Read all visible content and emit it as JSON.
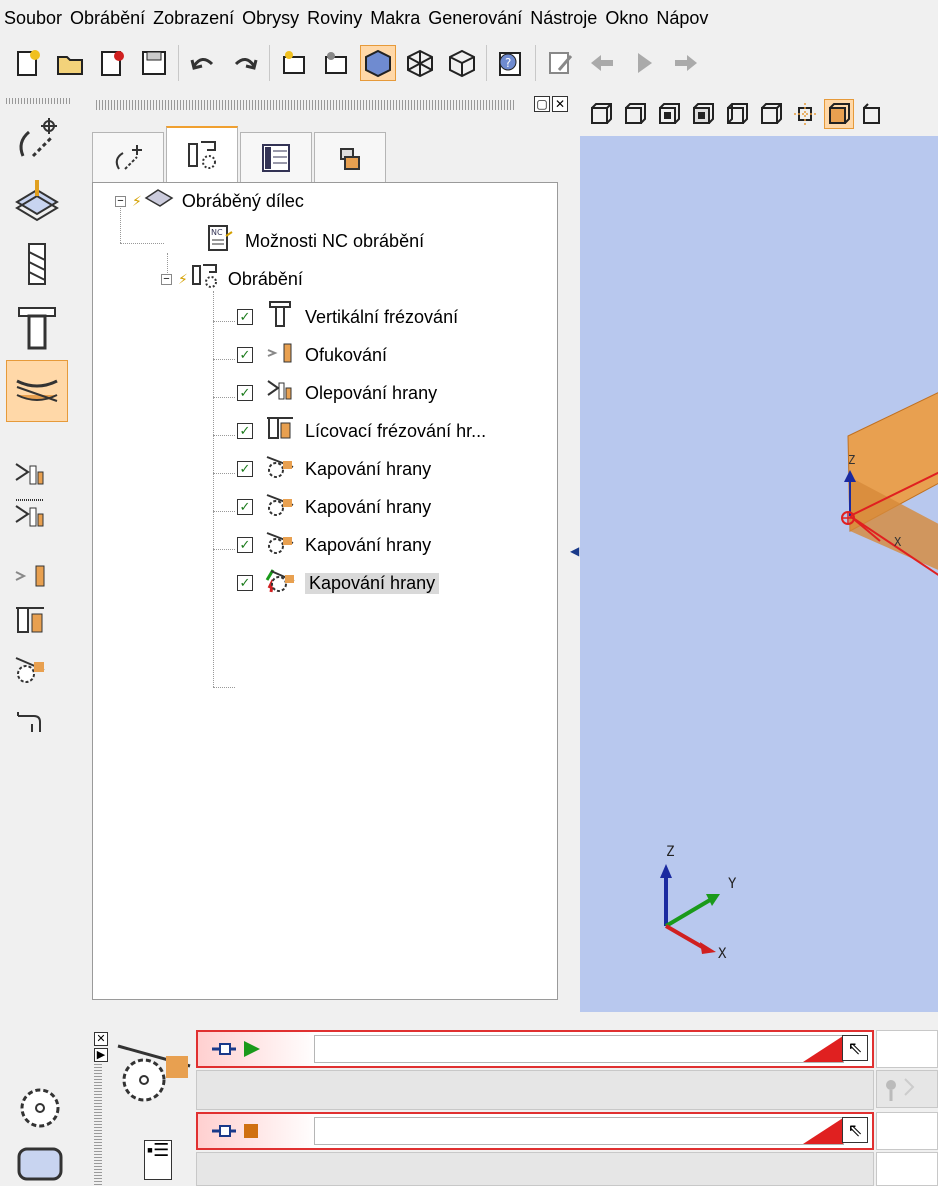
{
  "menu": [
    "Soubor",
    "Obrábění",
    "Zobrazení",
    "Obrysy",
    "Roviny",
    "Makra",
    "Generování",
    "Nástroje",
    "Okno",
    "Nápov"
  ],
  "toolbar": {
    "icons": [
      "new-document-icon",
      "open-folder-icon",
      "close-document-icon",
      "save-icon",
      "undo-icon",
      "redo-icon",
      "new-part-icon",
      "part-settings-icon",
      "solid-view-icon",
      "wireframe-view-icon",
      "hidden-line-view-icon",
      "help-icon",
      "edit-icon",
      "back-arrow-icon",
      "play-icon",
      "forward-arrow-icon"
    ]
  },
  "tree": {
    "root": "Obráběný dílec",
    "nc_options": "Možnosti NC obrábění",
    "machining": "Obrábění",
    "children": [
      "Vertikální frézování",
      "Ofukování",
      "Olepování hrany",
      "Lícovací frézování hr...",
      "Kapování hrany",
      "Kapování hrany",
      "Kapování hrany",
      "Kapování hrany"
    ],
    "selected_index": 7
  },
  "tabs": [
    "contour-tab-icon",
    "machining-tab-icon",
    "coordinates-tab-icon",
    "parts-tab-icon"
  ],
  "viewport": {
    "axes_main": {
      "z": "Z",
      "y": "Y",
      "x": "X"
    },
    "axes_part": {
      "z": "Z",
      "x": "X"
    },
    "background": "#b8c8ee",
    "part_color": "#e8a050"
  },
  "colors": {
    "accent": "#f0a030",
    "highlight_bg": "#ffd8a8",
    "error_red": "#e02020",
    "play_green": "#1a9a1a",
    "stop_orange": "#d07010"
  }
}
